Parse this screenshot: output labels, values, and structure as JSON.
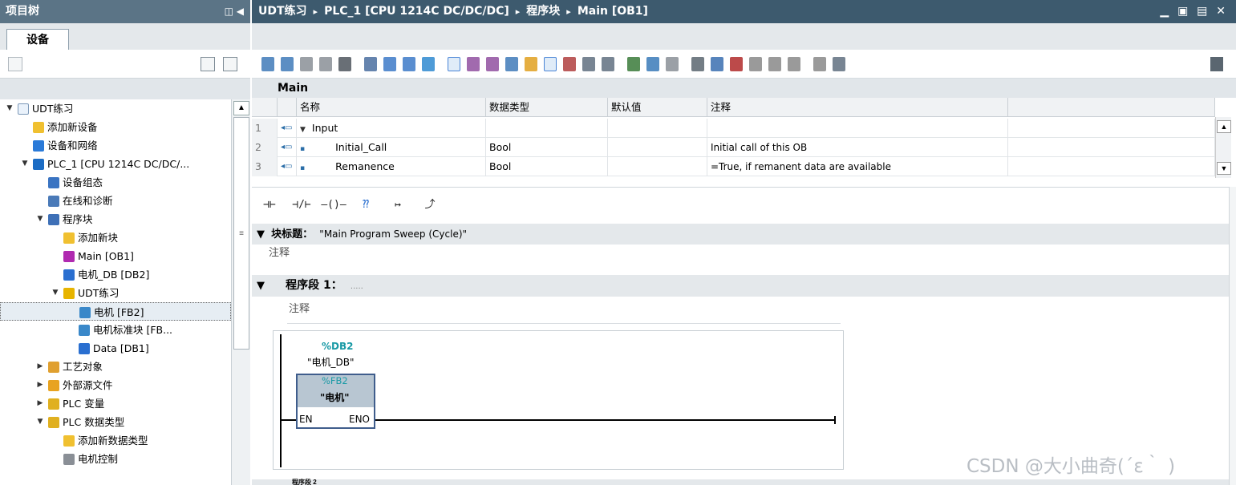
{
  "left_panel": {
    "title": "项目树",
    "title_controls": "◫ ◀",
    "devices_tab": "设备",
    "tree": [
      {
        "label": "UDT练习",
        "arrow": "▼",
        "icon": "project-icon"
      },
      {
        "label": "添加新设备",
        "arrow": "",
        "icon": "add-device-icon"
      },
      {
        "label": "设备和网络",
        "arrow": "",
        "icon": "network-icon"
      },
      {
        "label": "PLC_1 [CPU 1214C DC/DC/...",
        "arrow": "▼",
        "icon": "plc-icon"
      },
      {
        "label": "设备组态",
        "arrow": "",
        "icon": "device-config-icon"
      },
      {
        "label": "在线和诊断",
        "arrow": "",
        "icon": "online-diagnostics-icon"
      },
      {
        "label": "程序块",
        "arrow": "▼",
        "icon": "program-blocks-folder-icon"
      },
      {
        "label": "添加新块",
        "arrow": "",
        "icon": "add-block-icon"
      },
      {
        "label": "Main [OB1]",
        "arrow": "",
        "icon": "ob-icon"
      },
      {
        "label": "电机_DB [DB2]",
        "arrow": "",
        "icon": "db-icon"
      },
      {
        "label": "UDT练习",
        "arrow": "▼",
        "icon": "group-folder-icon"
      },
      {
        "label": "电机 [FB2]",
        "arrow": "",
        "icon": "fb-icon"
      },
      {
        "label": "电机标准块 [FB...",
        "arrow": "",
        "icon": "fb-icon"
      },
      {
        "label": "Data [DB1]",
        "arrow": "",
        "icon": "db-icon"
      },
      {
        "label": "工艺对象",
        "arrow": "▶",
        "icon": "technology-objects-icon"
      },
      {
        "label": "外部源文件",
        "arrow": "▶",
        "icon": "external-source-icon"
      },
      {
        "label": "PLC 变量",
        "arrow": "▶",
        "icon": "plc-tags-icon"
      },
      {
        "label": "PLC 数据类型",
        "arrow": "▼",
        "icon": "plc-datatypes-icon"
      },
      {
        "label": "添加新数据类型",
        "arrow": "",
        "icon": "add-datatype-icon"
      },
      {
        "label": "电机控制",
        "arrow": "",
        "icon": "udt-icon"
      }
    ]
  },
  "editor": {
    "breadcrumb": [
      "UDT练习",
      "PLC_1 [CPU 1214C DC/DC/DC]",
      "程序块",
      "Main [OB1]"
    ],
    "breadcrumb_sep": "▸",
    "window_controls": "▁ ▣ ▤ ✕",
    "block_name": "Main",
    "interface_headers": [
      "名称",
      "数据类型",
      "默认值",
      "注释"
    ],
    "interface_rows": [
      {
        "no": "1",
        "pin": "◂▭",
        "expander": "▼",
        "name": "Input",
        "type": "",
        "default": "",
        "comment": ""
      },
      {
        "no": "2",
        "pin": "◂▭",
        "expander": "▪",
        "name": "Initial_Call",
        "type": "Bool",
        "default": "",
        "comment": "Initial call of this OB"
      },
      {
        "no": "3",
        "pin": "◂▭",
        "expander": "▪",
        "name": "Remanence",
        "type": "Bool",
        "default": "",
        "comment": "=True, if remanent data are available"
      }
    ],
    "lad_elements": [
      "⊣⊢",
      "⊣/⊢",
      "–()–",
      "⁇",
      "↦",
      "⤴"
    ],
    "block_title_label": "块标题：",
    "block_title_value": "\"Main Program Sweep (Cycle)\"",
    "block_title_arrow": "▼",
    "block_comment": "注释",
    "segment_label": "程序段 1：",
    "segment_dots": ".....",
    "segment_comment": "注释",
    "network": {
      "db_address": "%DB2",
      "db_name": "\"电机_DB\"",
      "fb_address": "%FB2",
      "fb_name": "\"电机\"",
      "en": "EN",
      "eno": "ENO"
    },
    "next_segment_label": "程序段 2"
  },
  "watermark": "CSDN @大小曲奇(´ε｀ )"
}
